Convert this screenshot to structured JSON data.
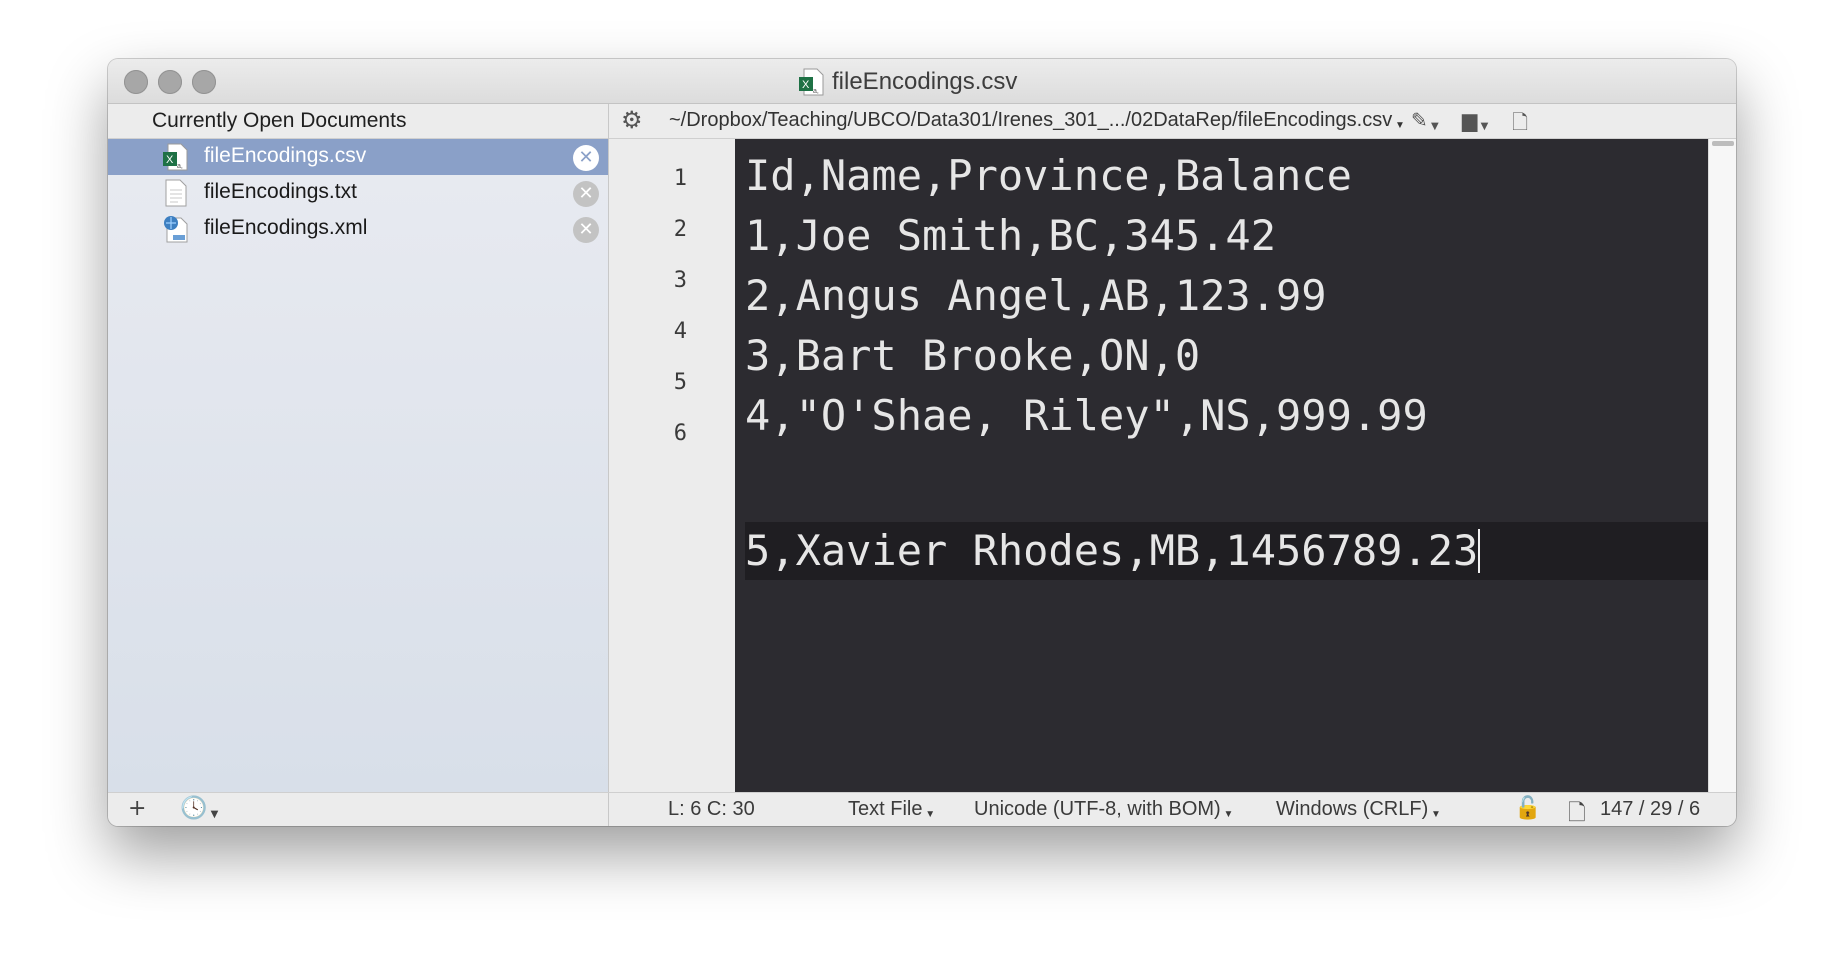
{
  "window": {
    "title": "fileEncodings.csv",
    "title_icon": "excel-csv-icon"
  },
  "sidebar": {
    "header": "Currently Open Documents",
    "documents": [
      {
        "name": "fileEncodings.csv",
        "icon": "excel-csv-icon",
        "selected": true
      },
      {
        "name": "fileEncodings.txt",
        "icon": "text-file-icon",
        "selected": false
      },
      {
        "name": "fileEncodings.xml",
        "icon": "xml-file-icon",
        "selected": false
      }
    ]
  },
  "pathbar": {
    "path": "~/Dropbox/Teaching/UBCO/Data301/Irenes_301_.../02DataRep/fileEncodings.csv"
  },
  "editor": {
    "line_numbers": [
      "1",
      "2",
      "3",
      "4",
      "5",
      "6"
    ],
    "lines": [
      "Id,Name,Province,Balance",
      "1,Joe Smith,BC,345.42",
      "2,Angus Angel,AB,123.99",
      "3,Bart Brooke,ON,0",
      "4,\"O'Shae, Riley\",NS,999.99",
      "5,Xavier Rhodes,MB,1456789.23"
    ],
    "current_line": 6
  },
  "statusbar": {
    "position": "L: 6 C: 30",
    "syntax": "Text File",
    "encoding": "Unicode (UTF-8, with BOM)",
    "line_endings": "Windows (CRLF)",
    "counts": "147 / 29 / 6"
  },
  "colors": {
    "editor_bg": "#2c2b30",
    "editor_text": "#e6e6e6",
    "selection": "#8aa0c8"
  }
}
